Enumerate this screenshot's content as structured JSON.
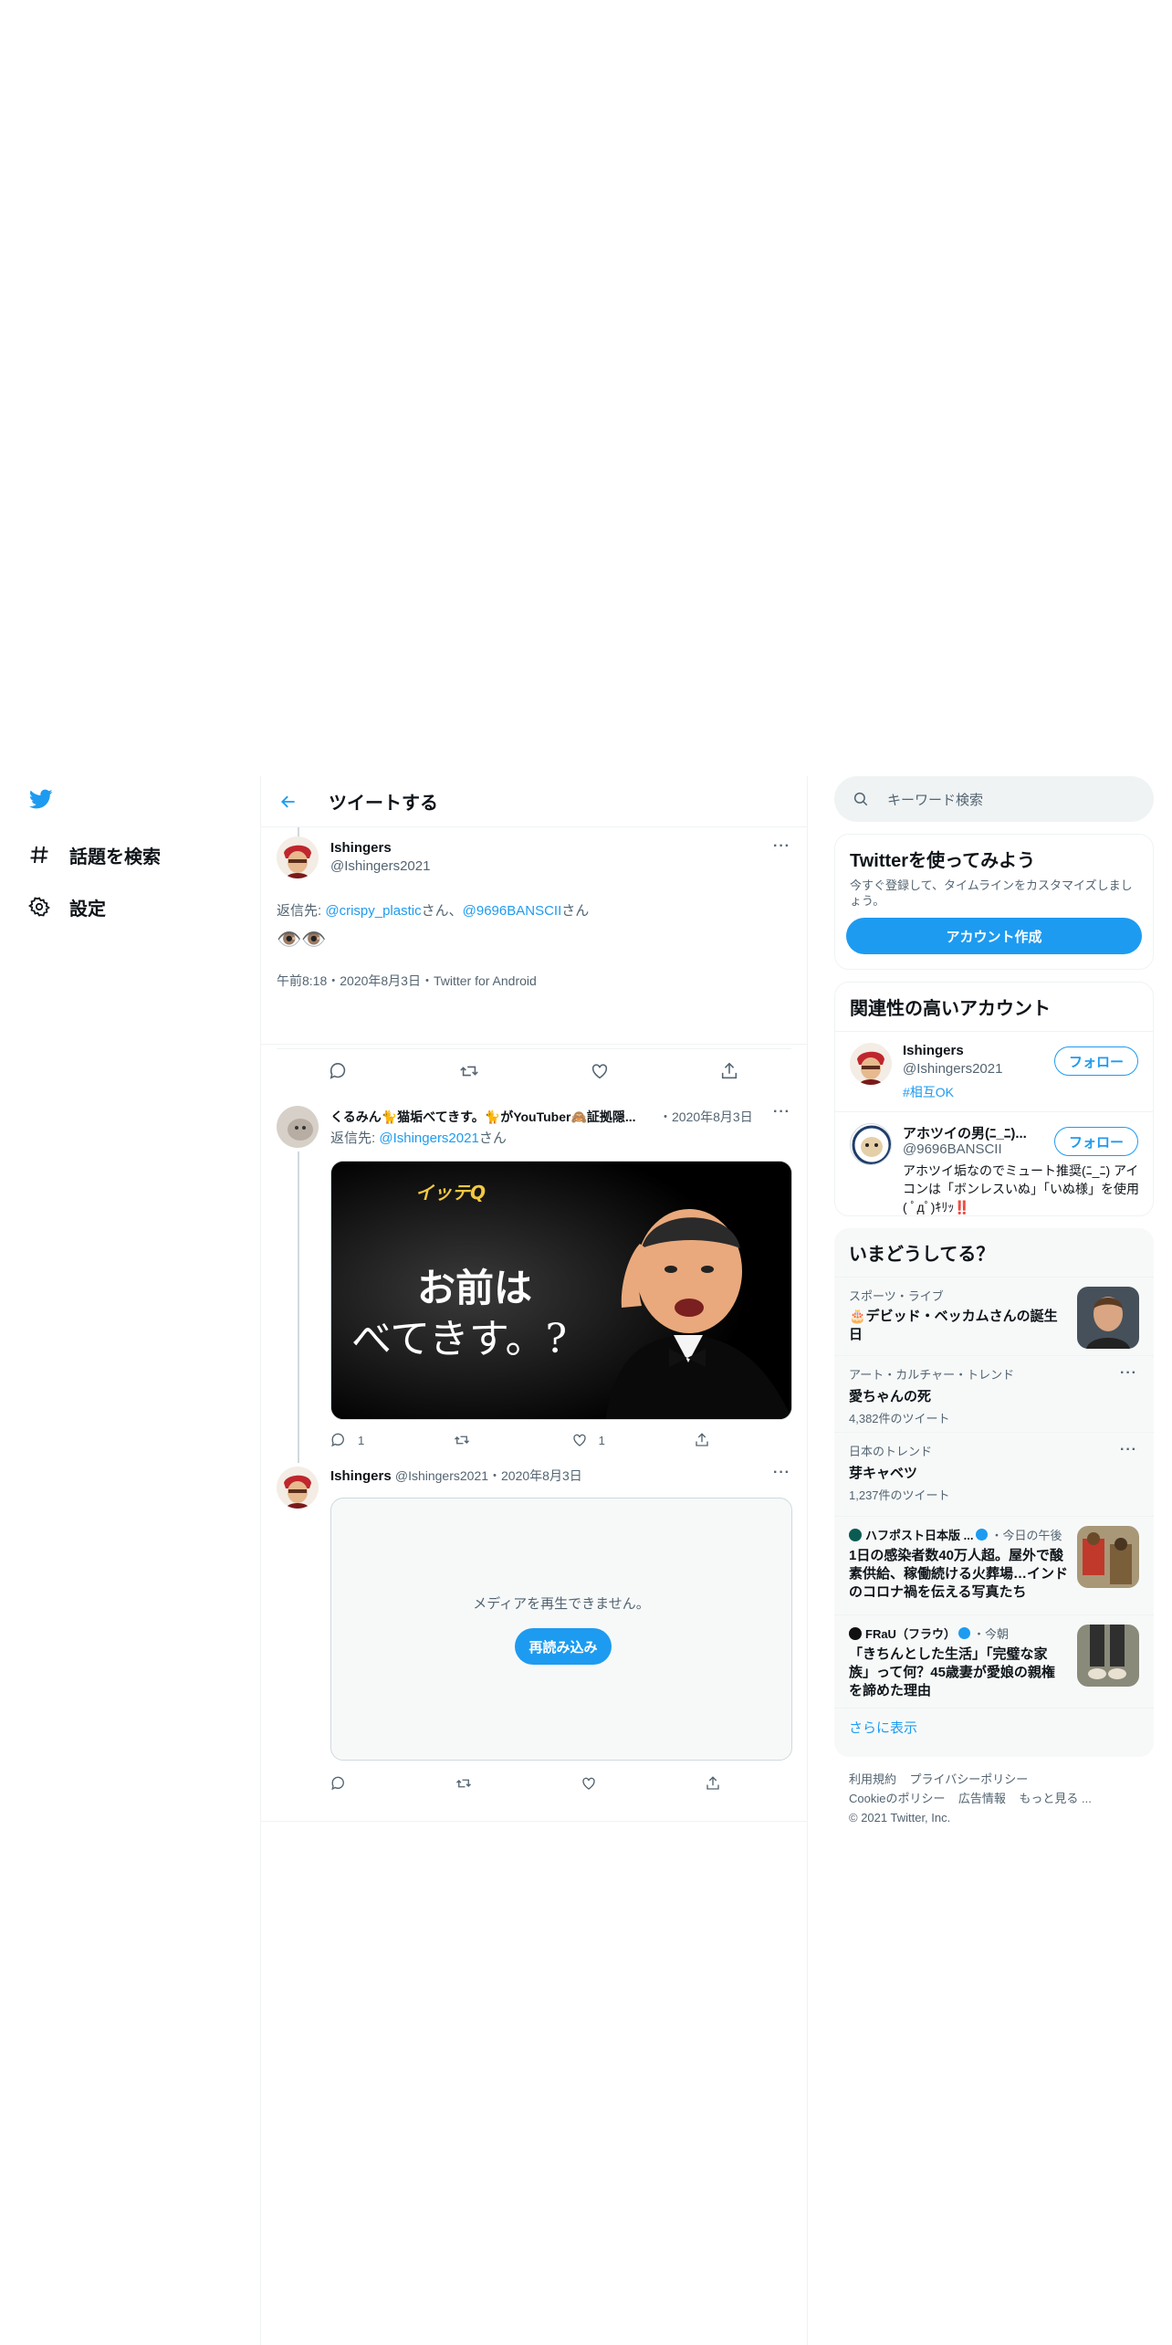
{
  "nav": {
    "explore_label": "話題を検索",
    "settings_label": "設定"
  },
  "header": {
    "title": "ツイートする"
  },
  "focused_tweet": {
    "name": "Ishingers",
    "handle": "@Ishingers2021",
    "reply_prefix": "返信先: ",
    "reply_user1": "@crispy_plastic",
    "reply_suffix1": "さん、",
    "reply_user2": "@9696BANSCII",
    "reply_suffix2": "さん",
    "text": "👁️👁️",
    "meta": "午前8:18・2020年8月3日・Twitter for Android"
  },
  "reply1": {
    "name": "くるみん🐈猫垢べてきす。🐈がYouTuber🙈証拠隠...",
    "date": "・2020年8月3日",
    "reply_prefix": "返信先: ",
    "reply_user": "@Ishingers2021",
    "reply_suffix": "さん",
    "image_text_top": "お前は",
    "image_text_bottom": "べてきす。?",
    "image_logo": "イッテQ",
    "reply_count": "1",
    "like_count": "1"
  },
  "reply2": {
    "name": "Ishingers",
    "handle_date": "@Ishingers2021・2020年8月3日",
    "media_error": "メディアを再生できません。",
    "reload_label": "再読み込み"
  },
  "right": {
    "search_placeholder": "キーワード検索",
    "signup": {
      "title": "Twitterを使ってみよう",
      "desc": "今すぐ登録して、タイムラインをカスタマイズしましょう。",
      "button": "アカウント作成"
    },
    "related": {
      "title": "関連性の高いアカウント",
      "accounts": [
        {
          "name": "Ishingers",
          "handle": "@Ishingers2021",
          "bio": "#相互OK",
          "follow": "フォロー"
        },
        {
          "name": "アホツイの男(ﾆ_ﾆ)...",
          "handle": "@9696BANSCII",
          "bio": "アホツイ垢なのでミュート推奨(ﾆ_ﾆ) アイコンは「ボンレスいぬ」「いぬ様」を使用( ﾟдﾟ)ｷﾘｯ‼️",
          "follow": "フォロー"
        }
      ]
    },
    "trends": {
      "title": "いまどうしてる？",
      "items": [
        {
          "context": "スポーツ・ライブ",
          "headline": "🎂デビッド・ベッカムさんの誕生日"
        },
        {
          "context": "アート・カルチャー・トレンド",
          "headline": "愛ちゃんの死",
          "count": "4,382件のツイート"
        },
        {
          "context": "日本のトレンド",
          "headline": "芽キャベツ",
          "count": "1,237件のツイート"
        },
        {
          "source": "ハフポスト日本版 ...",
          "time": "・今日の午後",
          "headline": "1日の感染者数40万人超。屋外で酸素供給、稼働続ける火葬場…インドのコロナ禍を伝える写真たち"
        },
        {
          "source": "FRaU（フラウ）",
          "time": "・今朝",
          "headline": "「きちんとした生活」「完璧な家族」って何？45歳妻が愛娘の親権を諦めた理由"
        }
      ],
      "show_more": "さらに表示"
    },
    "footer": {
      "terms": "利用規約",
      "privacy": "プライバシーポリシー",
      "cookie": "Cookieのポリシー",
      "ads": "広告情報",
      "more": "もっと見る ...",
      "copyright": "© 2021 Twitter, Inc."
    }
  },
  "colors": {
    "accent": "#1d9bf0",
    "text": "#0f1419",
    "muted": "#536471",
    "border": "#eff3f4"
  }
}
